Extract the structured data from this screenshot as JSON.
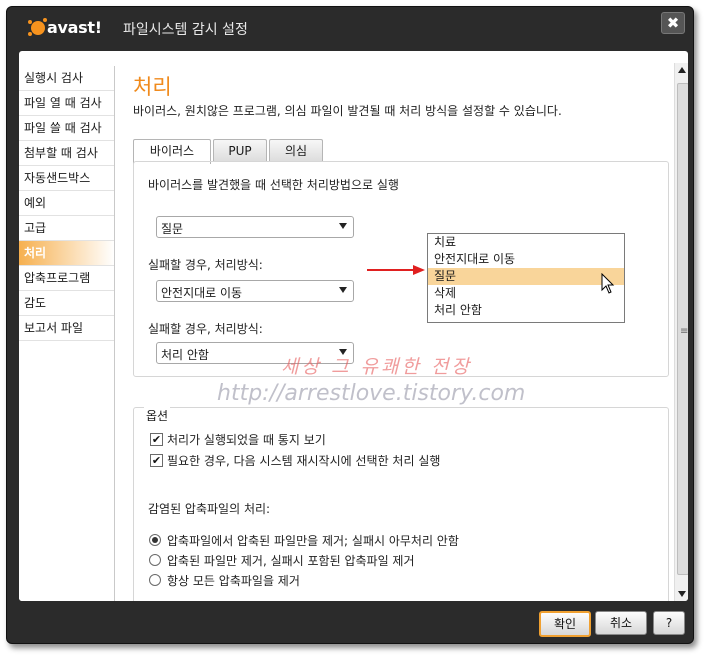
{
  "window": {
    "brand": "avast!",
    "title": "파일시스템 감시 설정",
    "close_symbol": "✖"
  },
  "sidebar": {
    "items": [
      {
        "label": "실행시 검사"
      },
      {
        "label": "파일 열 때 검사"
      },
      {
        "label": "파일 쓸 때 검사"
      },
      {
        "label": "첨부할 때 검사"
      },
      {
        "label": "자동샌드박스"
      },
      {
        "label": "예외"
      },
      {
        "label": "고급"
      },
      {
        "label": "처리",
        "active": true
      },
      {
        "label": "압축프로그램"
      },
      {
        "label": "감도"
      },
      {
        "label": "보고서 파일"
      }
    ]
  },
  "main": {
    "title": "처리",
    "description": "바이러스, 원치않은 프로그램, 의심 파일이 발견될 때 처리 방식을 설정할 수 있습니다.",
    "tabs": [
      {
        "label": "바이러스",
        "active": true
      },
      {
        "label": "PUP"
      },
      {
        "label": "의심"
      }
    ],
    "action_label": "바이러스를 발견했을 때 선택한 처리방법으로 실행",
    "action_select": "질문",
    "fallback1_label": "실패할 경우, 처리방식:",
    "fallback1_select": "안전지대로 이동",
    "fallback2_label": "실패할 경우, 처리방식:",
    "fallback2_select": "처리 안함",
    "dropdown_options": [
      {
        "label": "치료"
      },
      {
        "label": "안전지대로 이동"
      },
      {
        "label": "질문",
        "highlighted": true
      },
      {
        "label": "삭제"
      },
      {
        "label": "처리 안함"
      }
    ],
    "watermark_title": "세상 그 유쾌한 전장",
    "watermark_url": "http://arrestlove.tistory.com"
  },
  "options": {
    "title": "옵션",
    "checkboxes": [
      {
        "label": "처리가 실행되었을 때 통지 보기",
        "checked": true
      },
      {
        "label": "필요한 경우, 다음 시스템 재시작시에 선택한 처리 실행",
        "checked": true
      }
    ],
    "archive_label": "감염된 압축파일의 처리:",
    "radios": [
      {
        "label": "압축파일에서 압축된 파일만을 제거; 실패시 아무처리 안함",
        "selected": true
      },
      {
        "label": "압축된 파일만 제거, 실패시 포함된 압축파일 제거"
      },
      {
        "label": "항상 모든 압축파일을 제거"
      }
    ]
  },
  "footer": {
    "ok_label": "확인",
    "cancel_label": "취소",
    "help_label": "?"
  },
  "colors": {
    "accent": "#f08a1c",
    "window_frame": "#2b2b2b",
    "highlight": "#f9d59a",
    "arrow": "#e02020"
  }
}
